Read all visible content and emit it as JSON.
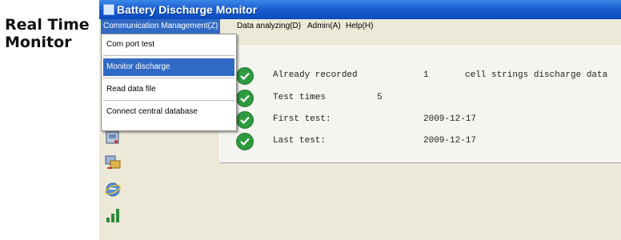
{
  "caption": {
    "line1": "Real Time",
    "line2": "Monitor"
  },
  "window": {
    "title": "Battery Discharge Monitor"
  },
  "menubar": [
    {
      "label": "Communication Management(Z)"
    },
    {
      "label": "Data analyzing(D)"
    },
    {
      "label": "Admin(A)"
    },
    {
      "label": "Help(H)"
    }
  ],
  "dropdown": {
    "items": [
      {
        "label": "Com port test"
      },
      {
        "label": "Monitor discharge"
      },
      {
        "label": "Read data file"
      },
      {
        "label": "Connect central database"
      }
    ]
  },
  "toolbar_icons": [
    "bms-icon",
    "drive-icon",
    "network-icon",
    "ie-icon",
    "signal-icon"
  ],
  "status_panel": {
    "rows": [
      {
        "label": "Already recorded",
        "value": "1",
        "note": "cell strings discharge data"
      },
      {
        "label": "Test times",
        "value": "5"
      },
      {
        "label": "First test:",
        "value": "2009-12-17"
      },
      {
        "label": "Last test:",
        "value": "2009-12-17"
      }
    ]
  },
  "colors": {
    "title_bar": "#0b4bbd",
    "menu_highlight": "#316ac5",
    "check": "#2d9a3f",
    "window_bg": "#ece9d8"
  }
}
